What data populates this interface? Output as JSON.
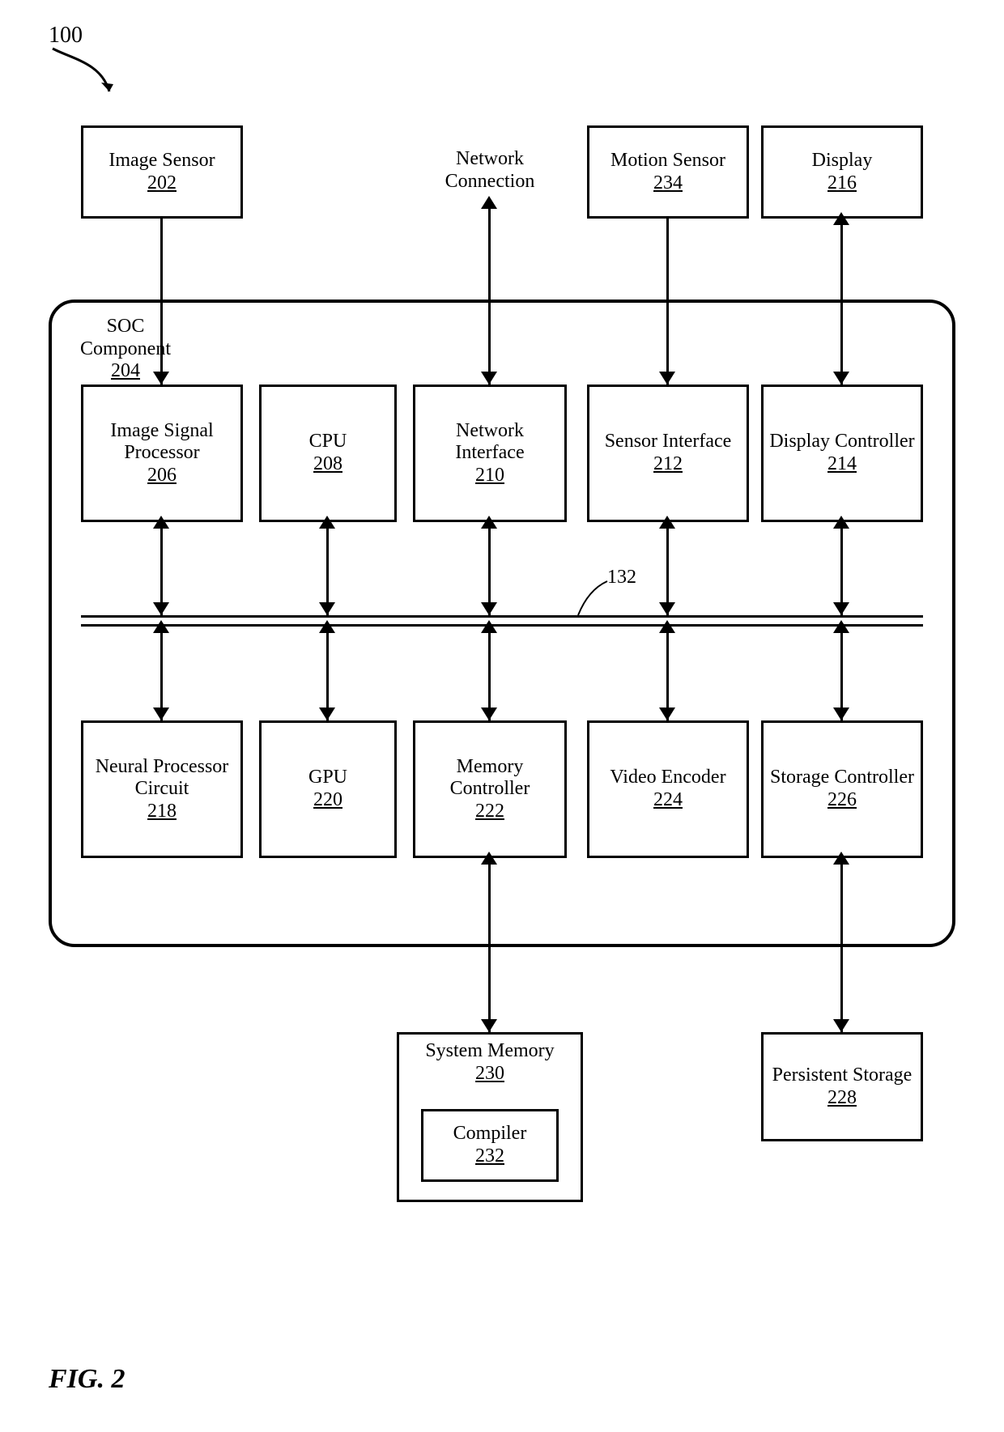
{
  "figure": {
    "number_label": "100",
    "bus_ref_label": "132",
    "caption": "FIG. 2"
  },
  "soc": {
    "label": "SOC Component",
    "num": "204"
  },
  "top_external": {
    "image_sensor": {
      "label": "Image Sensor",
      "num": "202"
    },
    "network": {
      "label": "Network Connection"
    },
    "motion_sensor": {
      "label": "Motion Sensor",
      "num": "234"
    },
    "display": {
      "label": "Display",
      "num": "216"
    }
  },
  "row1": {
    "isp": {
      "label": "Image Signal Processor",
      "num": "206"
    },
    "cpu": {
      "label": "CPU",
      "num": "208"
    },
    "netif": {
      "label": "Network Interface",
      "num": "210"
    },
    "sensorif": {
      "label": "Sensor Interface",
      "num": "212"
    },
    "dispctl": {
      "label": "Display Controller",
      "num": "214"
    }
  },
  "row2": {
    "npc": {
      "label": "Neural Processor Circuit",
      "num": "218"
    },
    "gpu": {
      "label": "GPU",
      "num": "220"
    },
    "memctl": {
      "label": "Memory Controller",
      "num": "222"
    },
    "venc": {
      "label": "Video Encoder",
      "num": "224"
    },
    "storctl": {
      "label": "Storage Controller",
      "num": "226"
    }
  },
  "bottom_external": {
    "sysmem": {
      "label": "System Memory",
      "num": "230"
    },
    "compiler": {
      "label": "Compiler",
      "num": "232"
    },
    "pstorage": {
      "label": "Persistent Storage",
      "num": "228"
    }
  }
}
